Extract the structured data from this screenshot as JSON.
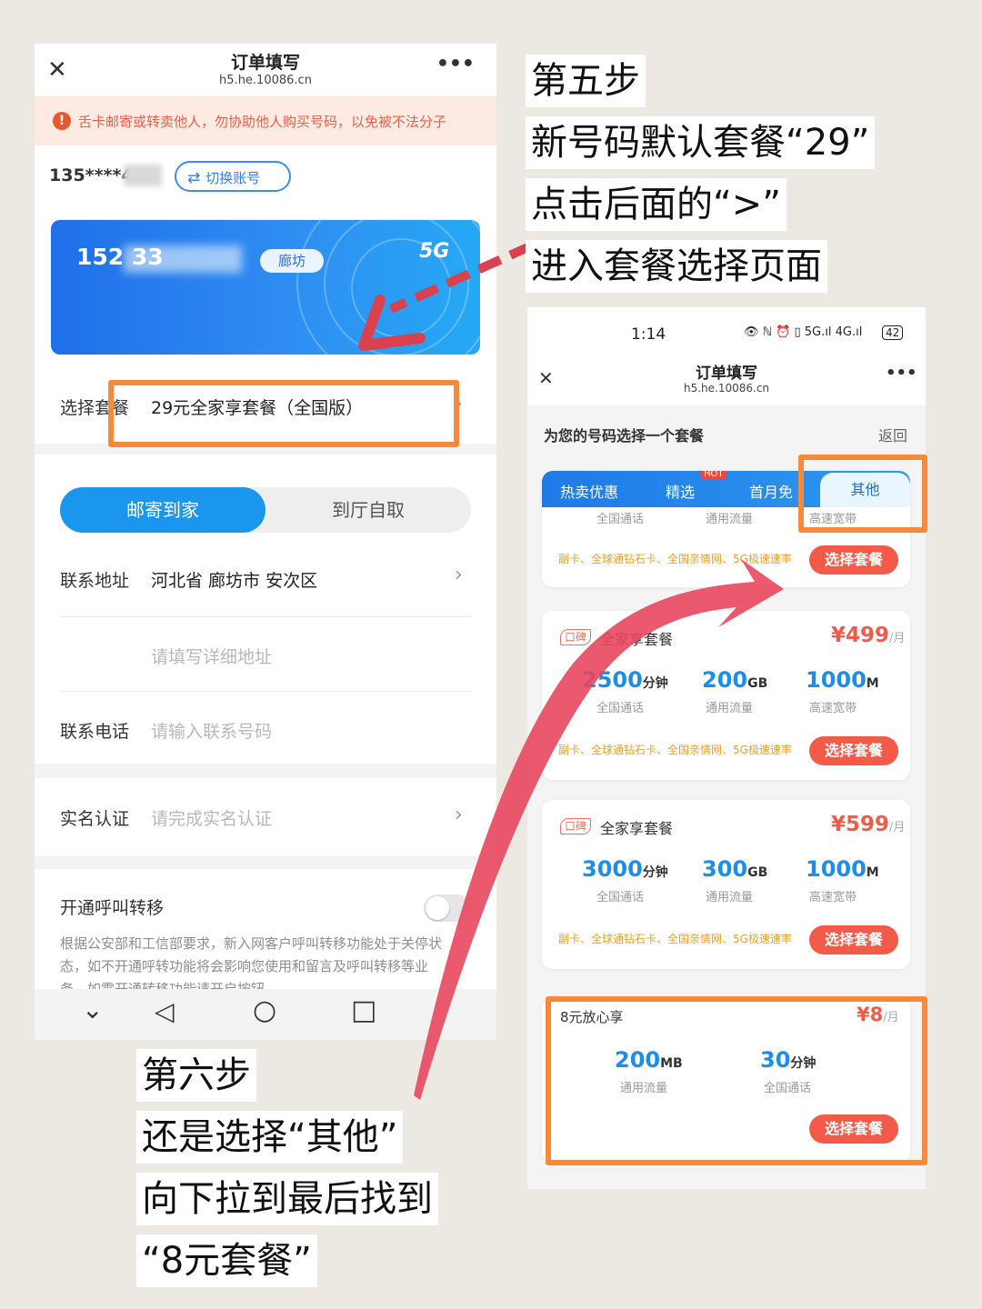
{
  "left_phone": {
    "nav": {
      "close_glyph": "✕",
      "title": "订单填写",
      "url": "h5.he.10086.cn",
      "more_glyph": "•••"
    },
    "notice": {
      "icon": "!",
      "text": "舌卡邮寄或转卖他人，勿协助他人购买号码，以免被不法分子"
    },
    "account": {
      "number": "135****4",
      "switch_label": "切换账号"
    },
    "number_card": {
      "number": "152 33",
      "city": "廊坊",
      "badge": "5G"
    },
    "package_row": {
      "label": "选择套餐",
      "value": "29元全家享套餐（全国版）"
    },
    "delivery_tabs": {
      "active": "邮寄到家",
      "inactive": "到厅自取"
    },
    "address": {
      "label": "联系地址",
      "value": "河北省 廊坊市 安次区",
      "detail_placeholder": "请填写详细地址"
    },
    "phone": {
      "label": "联系电话",
      "placeholder": "请输入联系号码"
    },
    "realname": {
      "label": "实名认证",
      "placeholder": "请完成实名认证"
    },
    "forwarding": {
      "label": "开通呼叫转移",
      "toggle_on": false,
      "note_lines": [
        "根据公安部和工信部要求，新入网客户呼叫转移功能处于关停状",
        "态，如不开通呼转功能将会影响您使用和留言及呼叫转移等业",
        "务，如需开通转移功能请开启按钮。"
      ]
    },
    "system_nav": {
      "down": "⌄",
      "back": "◁",
      "home": "○",
      "recent": "□"
    }
  },
  "right_phone": {
    "status": {
      "time": "1:14",
      "icons": "👁 ℕ ⏰ ▯ 5G.ıl 4G.ıl",
      "battery": "42"
    },
    "nav": {
      "close_glyph": "✕",
      "title": "订单填写",
      "url": "h5.he.10086.cn",
      "more_glyph": "•••"
    },
    "header": {
      "title": "为您的号码选择一个套餐",
      "back": "返回"
    },
    "tabs": [
      "热卖优惠",
      "精选",
      "首月免",
      "其他"
    ],
    "hot_badge": "HOT",
    "top_partial": {
      "sub": [
        "全国通话",
        "通用流量",
        "高速宽带"
      ],
      "features": "副卡、全球通钻石卡、全国亲情网、5G极速速率",
      "button": "选择套餐"
    },
    "plans": [
      {
        "tag": "口碑",
        "name": "全家享套餐",
        "price": "¥499",
        "unit": "/月",
        "stats": [
          {
            "v": "2500",
            "u": "分钟",
            "l": "全国通话"
          },
          {
            "v": "200",
            "u": "GB",
            "l": "通用流量"
          },
          {
            "v": "1000",
            "u": "M",
            "l": "高速宽带"
          }
        ],
        "features": "副卡、全球通钻石卡、全国亲情网、5G极速速率",
        "button": "选择套餐"
      },
      {
        "tag": "口碑",
        "name": "全家享套餐",
        "price": "¥599",
        "unit": "/月",
        "stats": [
          {
            "v": "3000",
            "u": "分钟",
            "l": "全国通话"
          },
          {
            "v": "300",
            "u": "GB",
            "l": "通用流量"
          },
          {
            "v": "1000",
            "u": "M",
            "l": "高速宽带"
          }
        ],
        "features": "副卡、全球通钻石卡、全国亲情网、5G极速速率",
        "button": "选择套餐"
      }
    ],
    "cheap_plan": {
      "name": "8元放心享",
      "price": "¥8",
      "unit": "/月",
      "stats": [
        {
          "v": "200",
          "u": "MB",
          "l": "通用流量"
        },
        {
          "v": "30",
          "u": "分钟",
          "l": "全国通话"
        }
      ],
      "button": "选择套餐"
    }
  },
  "captions": {
    "step5": [
      "第五步",
      "新号码默认套餐“29”",
      "点击后面的“>”",
      "进入套餐选择页面"
    ],
    "step6": [
      "第六步",
      "还是选择“其他”",
      "向下拉到最后找到",
      "“8元套餐”"
    ]
  },
  "colors": {
    "accent": "#1a96ee",
    "highlight": "#f6893a",
    "arrow": "#e8475e",
    "button": "#f35a48"
  }
}
